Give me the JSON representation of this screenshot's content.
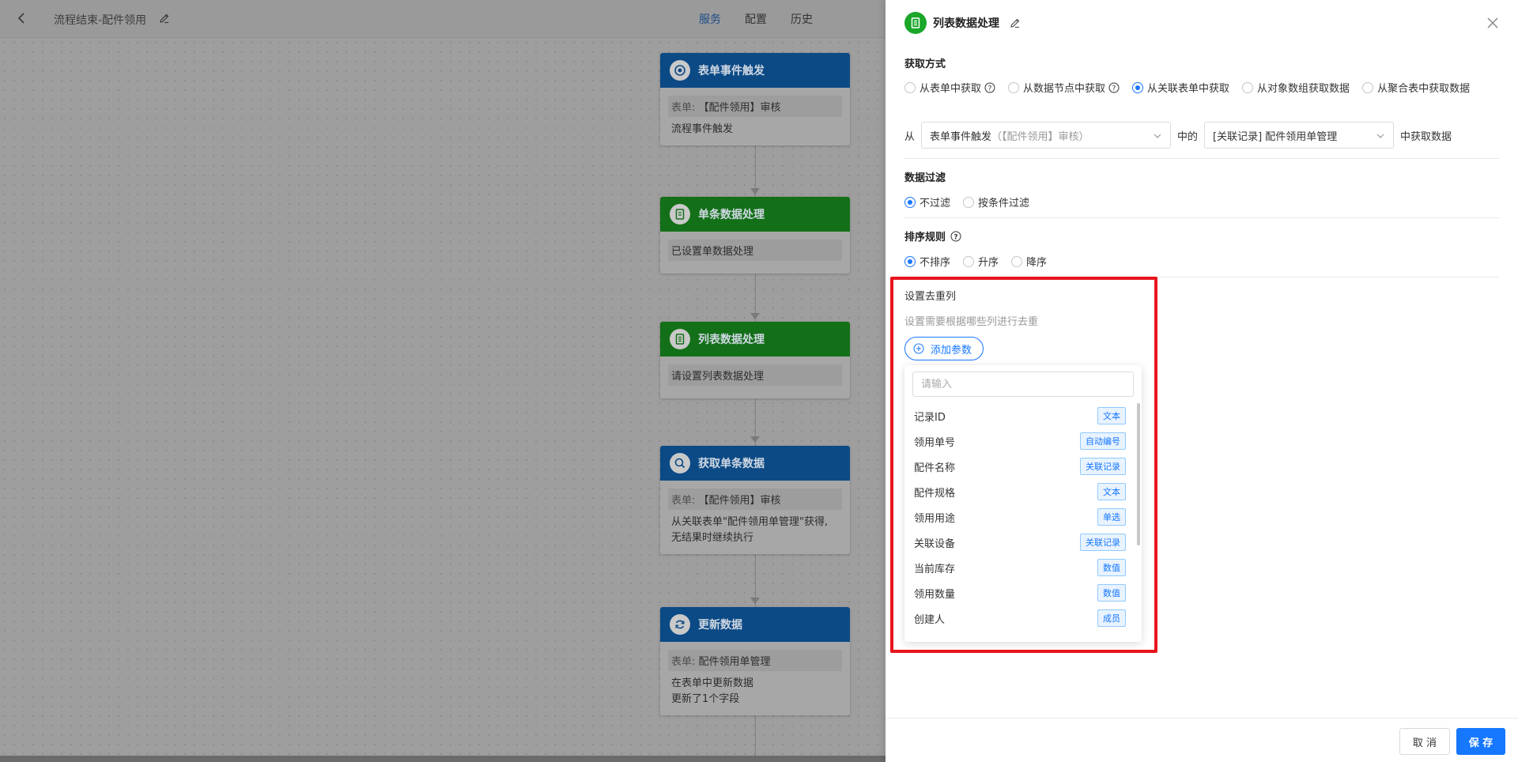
{
  "editor": {
    "title": "流程结束-配件领用",
    "tabs": [
      {
        "label": "服务",
        "active": true
      },
      {
        "label": "配置",
        "active": false
      },
      {
        "label": "历史",
        "active": false
      }
    ]
  },
  "nodes": [
    {
      "title": "表单事件触发",
      "color": "blue",
      "icon": "target-icon",
      "chip_label": "表单:",
      "chip_value": "【配件领用】审核",
      "lines": [
        "流程事件触发"
      ]
    },
    {
      "title": "单条数据处理",
      "color": "green",
      "icon": "document-icon",
      "chip_value": "已设置单数据处理",
      "lines": []
    },
    {
      "title": "列表数据处理",
      "color": "green",
      "icon": "list-icon",
      "chip_value": "请设置列表数据处理",
      "lines": []
    },
    {
      "title": "获取单条数据",
      "color": "blue",
      "icon": "search-icon",
      "chip_label": "表单:",
      "chip_value": "【配件领用】审核",
      "lines": [
        "从关联表单\"配件领用单管理\"获得,",
        "无结果时继续执行"
      ]
    },
    {
      "title": "更新数据",
      "color": "blue",
      "icon": "refresh-icon",
      "chip_label": "表单:",
      "chip_value": "配件领用单管理",
      "lines": [
        "在表单中更新数据",
        "更新了1个字段"
      ]
    }
  ],
  "drawer": {
    "title": "列表数据处理",
    "fetch": {
      "title": "获取方式",
      "options": [
        "从表单中获取",
        "从数据节点中获取",
        "从关联表单中获取",
        "从对象数组获取数据",
        "从聚合表中获取数据"
      ],
      "selected": 2
    },
    "from_row": {
      "prefix": "从",
      "source_main": "表单事件触发",
      "source_sub": "（【配件领用】审核）",
      "middle": "中的",
      "target": "[关联记录] 配件领用单管理",
      "suffix": "中获取数据"
    },
    "filter": {
      "title": "数据过滤",
      "options": [
        "不过滤",
        "按条件过滤"
      ],
      "selected": 0
    },
    "sort": {
      "title": "排序规则",
      "options": [
        "不排序",
        "升序",
        "降序"
      ],
      "selected": 0
    },
    "dedup": {
      "title": "设置去重列",
      "hint": "设置需要根据哪些列进行去重",
      "add_label": "添加参数",
      "search_placeholder": "请输入",
      "fields": [
        {
          "name": "记录ID",
          "type": "文本"
        },
        {
          "name": "领用单号",
          "type": "自动编号"
        },
        {
          "name": "配件名称",
          "type": "关联记录"
        },
        {
          "name": "配件规格",
          "type": "文本"
        },
        {
          "name": "领用用途",
          "type": "单选"
        },
        {
          "name": "关联设备",
          "type": "关联记录"
        },
        {
          "name": "当前库存",
          "type": "数值"
        },
        {
          "name": "领用数量",
          "type": "数值"
        },
        {
          "name": "创建人",
          "type": "成员"
        }
      ]
    },
    "cancel_label": "取 消",
    "save_label": "保 存"
  },
  "colors": {
    "primary": "#1677ff",
    "highlight": "#e8141c",
    "success": "#1ba72a"
  }
}
